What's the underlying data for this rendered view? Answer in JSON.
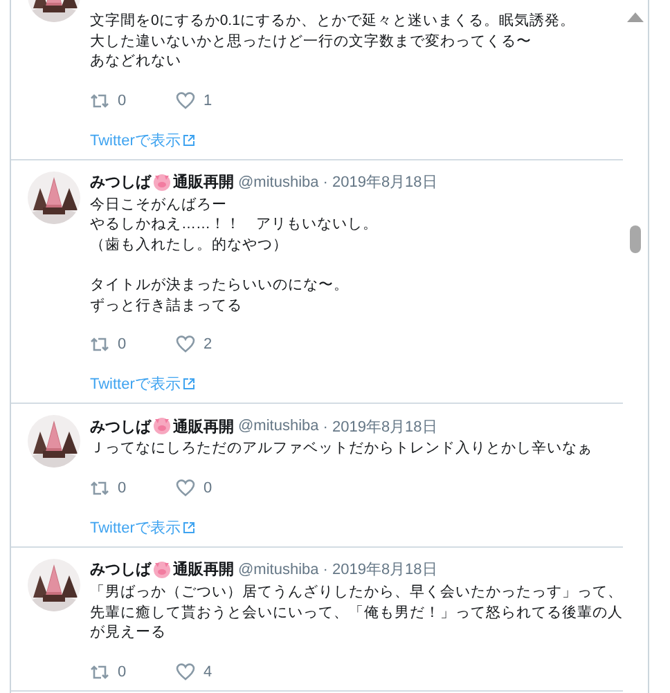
{
  "tweets": [
    {
      "body": [
        [
          "文字間を0にするか0.1にするか、とかで延々と迷いまくる。眠気誘発。",
          "大した違いないかと思ったけど一行の文字数まで変わってくる〜",
          "あなどれない"
        ]
      ],
      "retweets": "0",
      "likes": "1",
      "link": "Twitterで表示"
    },
    {
      "author": {
        "name": "みつしば",
        "tag": "通販再開",
        "handle": "@mitushiba",
        "date": "· 2019年8月18日"
      },
      "body": [
        [
          "今日こそがんばろー",
          "やるしかねえ……！！　アリもいないし。",
          "（歯も入れたし。的なやつ）"
        ],
        [
          "タイトルが決まったらいいのにな〜。",
          "ずっと行き詰まってる"
        ]
      ],
      "retweets": "0",
      "likes": "2",
      "link": "Twitterで表示"
    },
    {
      "author": {
        "name": "みつしば",
        "tag": "通販再開",
        "handle": "@mitushiba",
        "date": "· 2019年8月18日"
      },
      "body": [
        [
          "Ｊってなにしろただのアルファベットだからトレンド入りとかし辛いなぁ"
        ]
      ],
      "retweets": "0",
      "likes": "0",
      "link": "Twitterで表示"
    },
    {
      "author": {
        "name": "みつしば",
        "tag": "通販再開",
        "handle": "@mitushiba",
        "date": "· 2019年8月18日"
      },
      "body": [
        [
          "「男ばっか（ごつい）居てうんざりしたから、早く会いたかったっす」って、",
          "先輩に癒して貰おうと会いにいって、「俺も男だ！」って怒られてる後輩の人",
          "が見えーる"
        ]
      ],
      "retweets": "0",
      "likes": "4"
    }
  ]
}
